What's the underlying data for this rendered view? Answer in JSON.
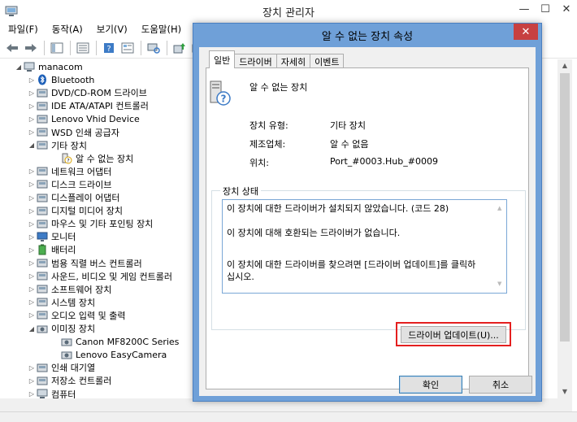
{
  "window": {
    "title": "장치 관리자",
    "minimize": "—",
    "maximize": "☐",
    "close": "✕"
  },
  "menu": [
    {
      "label": "파일(F)"
    },
    {
      "label": "동작(A)"
    },
    {
      "label": "보기(V)"
    },
    {
      "label": "도움말(H)"
    }
  ],
  "tree": [
    {
      "label": "manacom",
      "level": 0,
      "expander": "◢",
      "icon": "computer-icon"
    },
    {
      "label": "Bluetooth",
      "level": 1,
      "expander": "▷",
      "icon": "bluetooth-icon"
    },
    {
      "label": "DVD/CD-ROM 드라이브",
      "level": 1,
      "expander": "▷",
      "icon": "disc-drive-icon"
    },
    {
      "label": "IDE ATA/ATAPI 컨트롤러",
      "level": 1,
      "expander": "▷",
      "icon": "ide-controller-icon"
    },
    {
      "label": "Lenovo Vhid Device",
      "level": 1,
      "expander": "▷",
      "icon": "device-icon"
    },
    {
      "label": "WSD 인쇄 공급자",
      "level": 1,
      "expander": "▷",
      "icon": "printer-icon"
    },
    {
      "label": "기타 장치",
      "level": 1,
      "expander": "◢",
      "icon": "other-device-icon"
    },
    {
      "label": "알 수 없는 장치",
      "level": 2,
      "expander": "",
      "icon": "unknown-device-icon"
    },
    {
      "label": "네트워크 어댑터",
      "level": 1,
      "expander": "▷",
      "icon": "network-adapter-icon"
    },
    {
      "label": "디스크 드라이브",
      "level": 1,
      "expander": "▷",
      "icon": "disk-drive-icon"
    },
    {
      "label": "디스플레이 어댑터",
      "level": 1,
      "expander": "▷",
      "icon": "display-adapter-icon"
    },
    {
      "label": "디지털 미디어 장치",
      "level": 1,
      "expander": "▷",
      "icon": "media-device-icon"
    },
    {
      "label": "마우스 및 기타 포인팅 장치",
      "level": 1,
      "expander": "▷",
      "icon": "mouse-icon"
    },
    {
      "label": "모니터",
      "level": 1,
      "expander": "▷",
      "icon": "monitor-icon"
    },
    {
      "label": "배터리",
      "level": 1,
      "expander": "▷",
      "icon": "battery-icon"
    },
    {
      "label": "범용 직렬 버스 컨트롤러",
      "level": 1,
      "expander": "▷",
      "icon": "usb-icon"
    },
    {
      "label": "사운드, 비디오 및 게임 컨트롤러",
      "level": 1,
      "expander": "▷",
      "icon": "sound-icon"
    },
    {
      "label": "소프트웨어 장치",
      "level": 1,
      "expander": "▷",
      "icon": "software-device-icon"
    },
    {
      "label": "시스템 장치",
      "level": 1,
      "expander": "▷",
      "icon": "system-device-icon"
    },
    {
      "label": "오디오 입력 및 출력",
      "level": 1,
      "expander": "▷",
      "icon": "audio-icon"
    },
    {
      "label": "이미징 장치",
      "level": 1,
      "expander": "◢",
      "icon": "camera-icon"
    },
    {
      "label": "Canon MF8200C Series",
      "level": 2,
      "expander": "",
      "icon": "camera-icon"
    },
    {
      "label": "Lenovo EasyCamera",
      "level": 2,
      "expander": "",
      "icon": "camera-icon"
    },
    {
      "label": "인쇄 대기열",
      "level": 1,
      "expander": "▷",
      "icon": "print-queue-icon"
    },
    {
      "label": "저장소 컨트롤러",
      "level": 1,
      "expander": "▷",
      "icon": "storage-controller-icon"
    },
    {
      "label": "컴퓨터",
      "level": 1,
      "expander": "▷",
      "icon": "computer-icon"
    }
  ],
  "dialog": {
    "title": "알 수 없는 장치 속성",
    "close": "✕",
    "tabs": [
      {
        "label": "일반",
        "active": true
      },
      {
        "label": "드라이버",
        "active": false
      },
      {
        "label": "자세히",
        "active": false
      },
      {
        "label": "이벤트",
        "active": false
      }
    ],
    "device_name": "알 수 없는 장치",
    "props": [
      {
        "label": "장치 유형:",
        "value": "기타 장치"
      },
      {
        "label": "제조업체:",
        "value": "알 수 없음"
      },
      {
        "label": "위치:",
        "value": "Port_#0003.Hub_#0009"
      }
    ],
    "status_group_title": "장치 상태",
    "status_lines": [
      "이 장치에 대한 드라이버가 설치되지 않았습니다. (코드 28)",
      "",
      "이 장치에 대해 호환되는 드라이버가 없습니다.",
      "",
      "",
      "이 장치에 대한 드라이버를 찾으려면 [드라이버 업데이트]를 클릭하",
      "십시오."
    ],
    "update_button": "드라이버 업데이트(U)...",
    "ok_button": "확인",
    "cancel_button": "취소",
    "highlight_color": "#e41f1f"
  }
}
